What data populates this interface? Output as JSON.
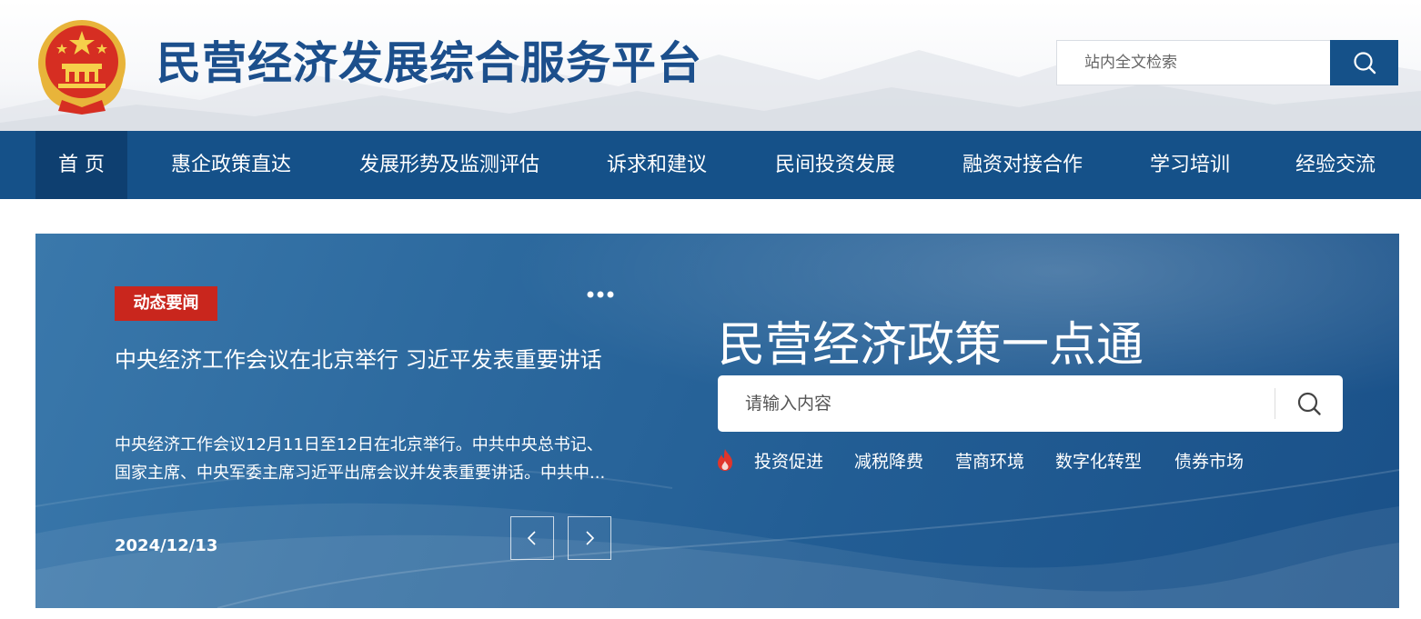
{
  "header": {
    "site_title": "民营经济发展综合服务平台",
    "search_placeholder": "站内全文检索"
  },
  "nav": {
    "items": [
      {
        "label": "首 页",
        "active": true
      },
      {
        "label": "惠企政策直达"
      },
      {
        "label": "发展形势及监测评估"
      },
      {
        "label": "诉求和建议"
      },
      {
        "label": "民间投资发展"
      },
      {
        "label": "融资对接合作"
      },
      {
        "label": "学习培训"
      },
      {
        "label": "经验交流"
      }
    ]
  },
  "news": {
    "tag": "动态要闻",
    "title": "中央经济工作会议在北京举行 习近平发表重要讲话",
    "summary": "中央经济工作会议12月11日至12日在北京举行。中共中央总书记、国家主席、中央军委主席习近平出席会议并发表重要讲话。中共中...",
    "date": "2024/12/13"
  },
  "policy": {
    "title": "民营经济政策一点通",
    "search_placeholder": "请输入内容",
    "hot_tags": [
      "投资促进",
      "减税降费",
      "营商环境",
      "数字化转型",
      "债券市场"
    ]
  },
  "colors": {
    "brand_blue": "#155189",
    "nav_active": "#0e3f70",
    "tag_red": "#c9261d",
    "title_blue": "#1c4f8c"
  },
  "icons": {
    "emblem": "national-emblem-icon",
    "search": "search-icon",
    "more": "more-dots-icon",
    "prev": "chevron-left-icon",
    "next": "chevron-right-icon",
    "hot": "flame-icon"
  }
}
